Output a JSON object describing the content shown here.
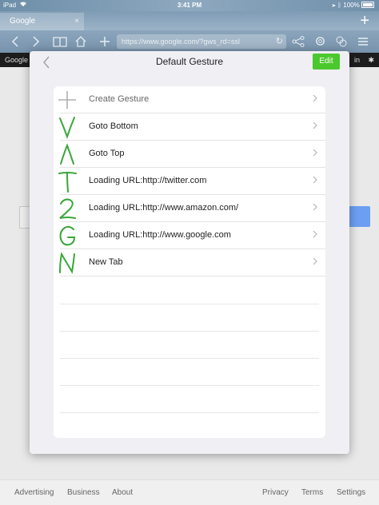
{
  "status_bar": {
    "device": "iPad",
    "time": "3:41 PM",
    "battery": "100%"
  },
  "browser": {
    "tab_title": "Google",
    "tab_close": "×",
    "new_tab": "+",
    "url": "https://www.google.com/?gws_rd=ssl",
    "page_bar_left": "Google",
    "page_bar_right": "in"
  },
  "footer": {
    "links": [
      "Advertising",
      "Business",
      "About",
      "Privacy",
      "Terms",
      "Settings"
    ]
  },
  "modal": {
    "title": "Default Gesture",
    "edit_label": "Edit",
    "gestures": [
      {
        "glyph": "plus",
        "label": "Create Gesture"
      },
      {
        "glyph": "V",
        "label": "Goto Bottom"
      },
      {
        "glyph": "Λ",
        "label": "Goto Top"
      },
      {
        "glyph": "T",
        "label": "Loading URL:http://twitter.com"
      },
      {
        "glyph": "2",
        "label": "Loading URL:http://www.amazon.com/"
      },
      {
        "glyph": "G",
        "label": "Loading URL:http://www.google.com"
      },
      {
        "glyph": "N",
        "label": "New Tab"
      }
    ]
  },
  "colors": {
    "accent_green": "#4cc82f",
    "gesture_green": "#3aa63a"
  },
  "icons": [
    "back-arrow-icon",
    "forward-arrow-icon",
    "bookmarks-book-icon",
    "home-icon",
    "plus-icon",
    "refresh-icon",
    "share-icon",
    "settings-gear-icon",
    "gesture-icon",
    "menu-icon",
    "chevron-right-icon",
    "chevron-left-icon"
  ]
}
